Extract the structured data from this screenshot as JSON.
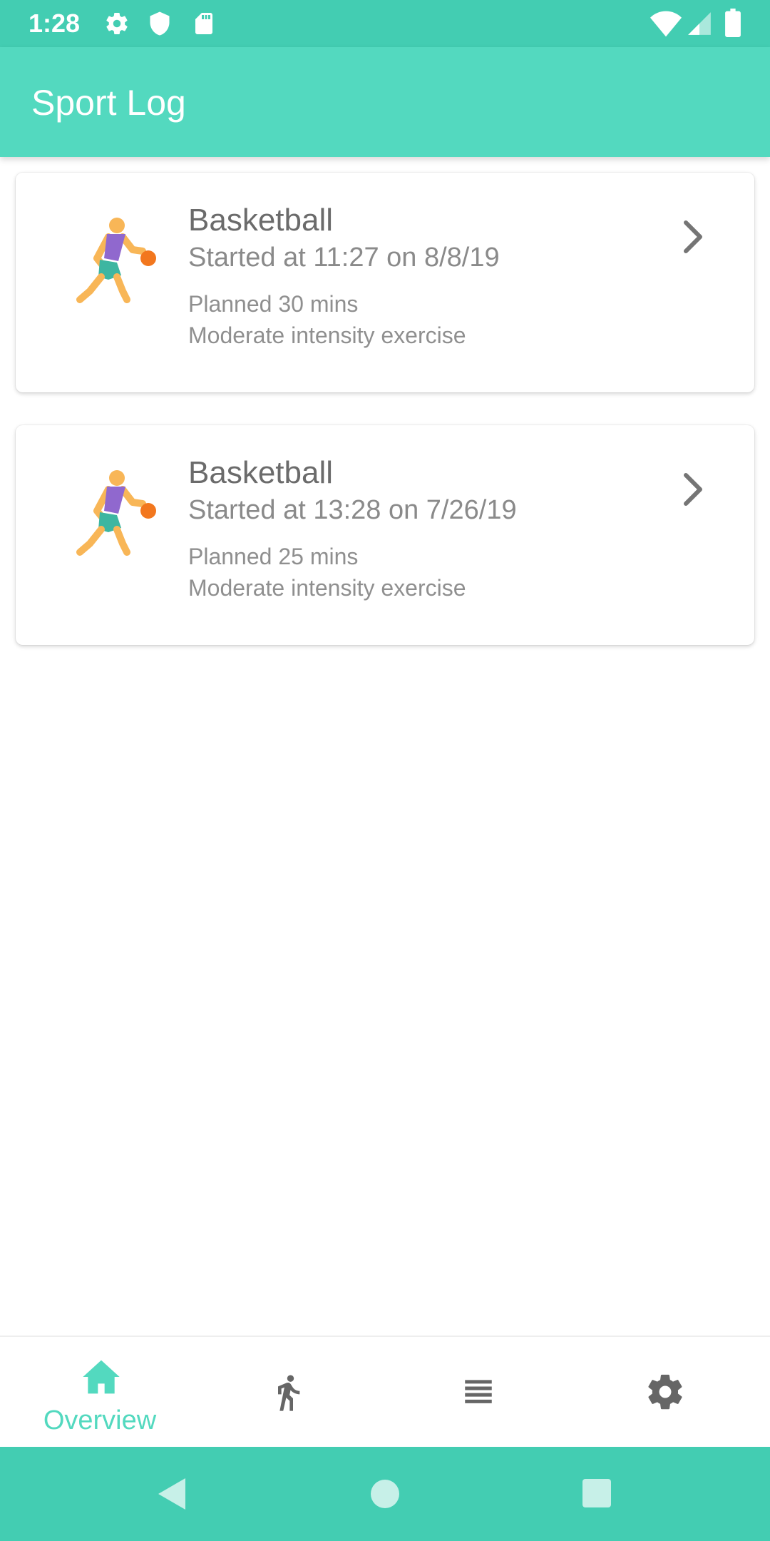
{
  "status_bar": {
    "time": "1:28",
    "icons": [
      "gear-icon",
      "shield-icon",
      "sd-card-icon",
      "wifi-icon",
      "signal-icon",
      "battery-icon"
    ]
  },
  "app_bar": {
    "title": "Sport Log"
  },
  "activities": [
    {
      "sport": "Basketball",
      "started": "Started at 11:27 on 8/8/19",
      "planned": "Planned 30 mins",
      "intensity": "Moderate intensity exercise",
      "icon": "basketball-player-icon"
    },
    {
      "sport": "Basketball",
      "started": "Started at 13:28 on 7/26/19",
      "planned": "Planned 25 mins",
      "intensity": "Moderate intensity exercise",
      "icon": "basketball-player-icon"
    }
  ],
  "bottom_nav": {
    "items": [
      {
        "label": "Overview",
        "icon": "home-icon",
        "active": true
      },
      {
        "label": "",
        "icon": "running-icon",
        "active": false
      },
      {
        "label": "",
        "icon": "list-icon",
        "active": false
      },
      {
        "label": "",
        "icon": "gear-icon",
        "active": false
      }
    ]
  },
  "colors": {
    "primary": "#53d9bf",
    "primary_dark": "#43cdb2",
    "text_secondary": "#757575",
    "icon_inactive": "#666666"
  }
}
